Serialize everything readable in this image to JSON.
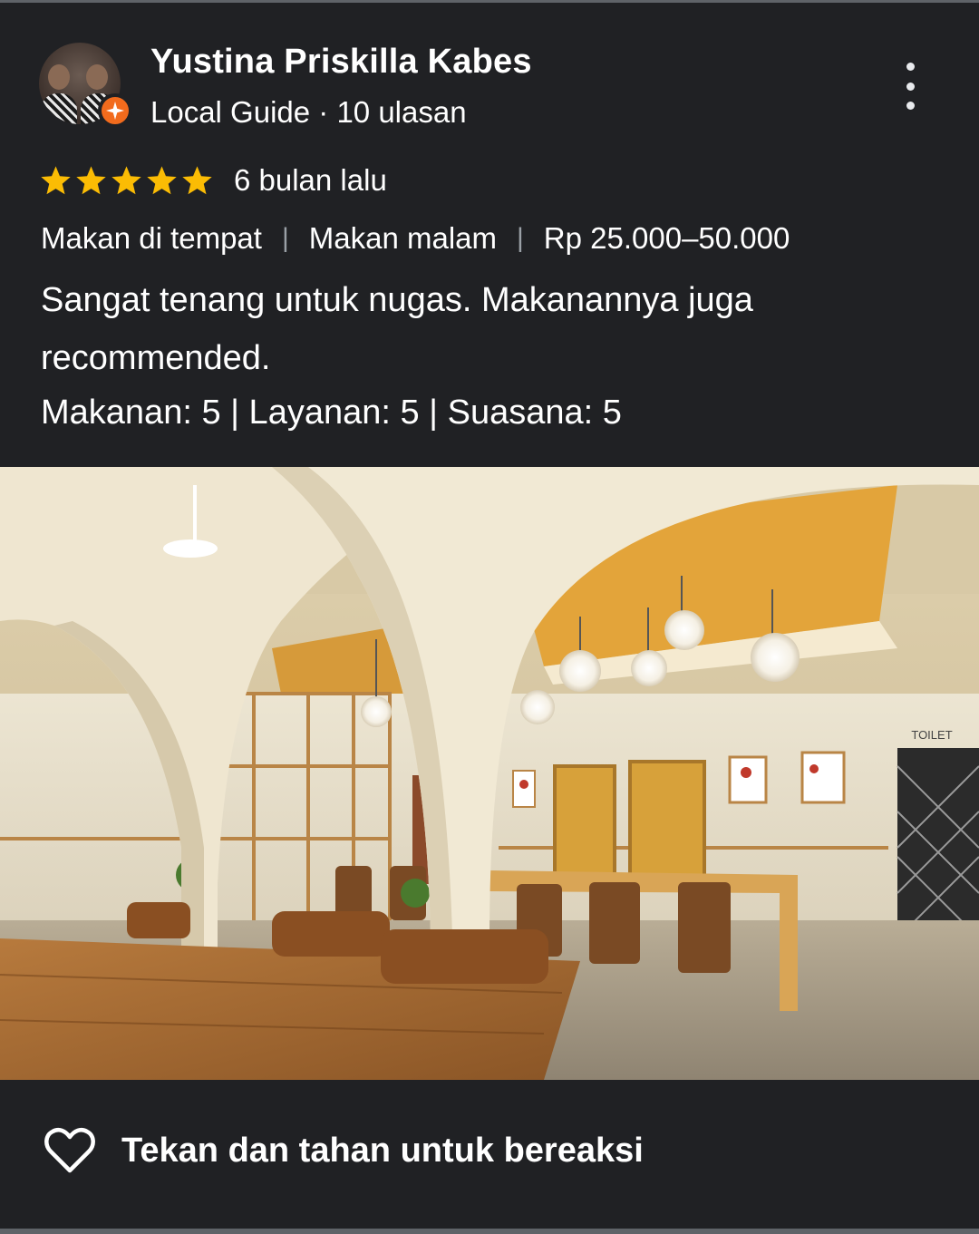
{
  "reviewer": {
    "name": "Yustina Priskilla Kabes",
    "subtitle": "Local Guide · 10 ulasan"
  },
  "rating": {
    "stars": 5,
    "max_stars": 5,
    "time_ago": "6 bulan lalu",
    "star_color": "#fbbc04"
  },
  "tags": {
    "service": "Makan di tempat",
    "meal": "Makan malam",
    "price": "Rp 25.000–50.000"
  },
  "review_text": "Sangat tenang untuk nugas. Makanannya juga recommended.",
  "scores_text": "Makanan: 5 | Layanan: 5 | Suasana: 5",
  "photo": {
    "sign_text": "TOILET"
  },
  "reaction": {
    "label": "Tekan dan tahan untuk bereaksi"
  },
  "colors": {
    "background": "#202124",
    "badge": "#f26b1d"
  }
}
